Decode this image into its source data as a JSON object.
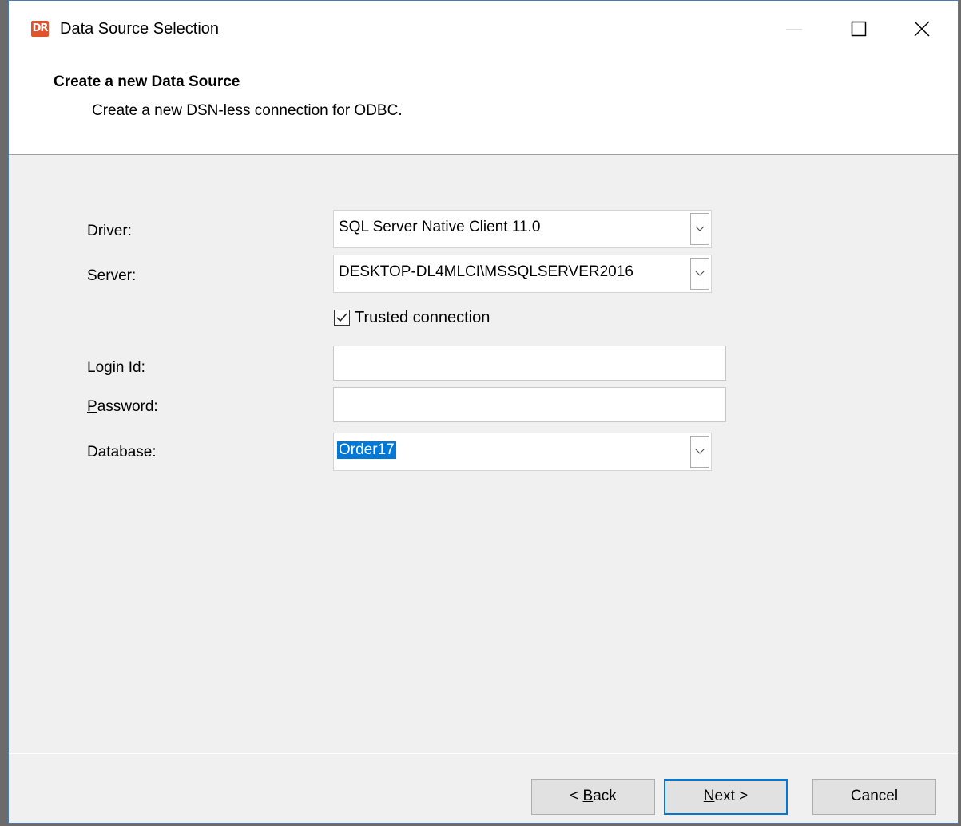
{
  "window": {
    "title": "Data Source Selection",
    "app_icon_text": "DR",
    "colors": {
      "accent": "#0078d7",
      "app_icon": "#e2522b"
    }
  },
  "header": {
    "title": "Create a new Data Source",
    "subtitle": "Create a new DSN-less connection for ODBC."
  },
  "form": {
    "driver": {
      "label": "Driver:",
      "value": "SQL Server Native Client 11.0"
    },
    "server": {
      "label": "Server:",
      "value": "DESKTOP-DL4MLCI\\MSSQLSERVER2016"
    },
    "trusted_connection": {
      "label": "Trusted connection",
      "checked": true
    },
    "login_id": {
      "label_mnemonic": "L",
      "label_rest": "ogin Id:",
      "value": ""
    },
    "password": {
      "label_mnemonic": "P",
      "label_rest": "assword:",
      "value": ""
    },
    "database": {
      "label": "Database:",
      "value": "Order17"
    }
  },
  "buttons": {
    "back": {
      "prefix": "< ",
      "mnemonic": "B",
      "rest": "ack"
    },
    "next": {
      "mnemonic": "N",
      "rest": "ext >"
    },
    "cancel": {
      "label": "Cancel"
    }
  },
  "icons": {
    "app": "app-logo-icon",
    "minimize": "minimize-icon",
    "maximize": "maximize-icon",
    "close": "close-icon",
    "dropdown": "chevron-down-icon",
    "check": "checkmark-icon"
  }
}
